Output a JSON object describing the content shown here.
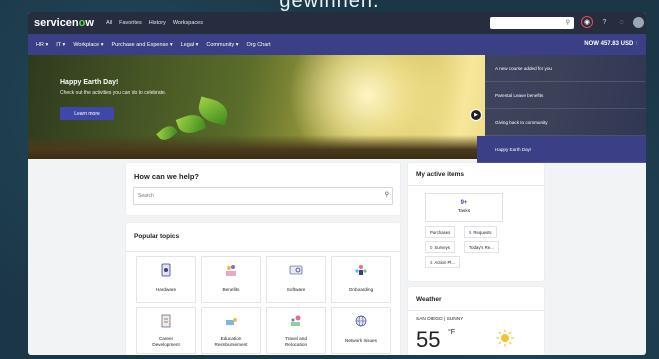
{
  "caption": "gewinnen.",
  "topbar": {
    "logo_pre": "servicen",
    "logo_o": "o",
    "logo_post": "w",
    "links": [
      "All",
      "Favorites",
      "History",
      "Workspaces"
    ]
  },
  "subnav": {
    "items": [
      "HR ▾",
      "IT ▾",
      "Workplace ▾",
      "Purchase and Expense ▾",
      "Legal ▾",
      "Community ▾",
      "Org Chart"
    ],
    "balance": "NOW 457.83 USD",
    "balance_arrow": "↑"
  },
  "hero": {
    "title": "Happy Earth Day!",
    "subtitle": "Check out the activities you can do to celebrate.",
    "button": "Learn more"
  },
  "carousel": {
    "items": [
      "A new course added for you",
      "Parental Leave benefits",
      "Giving back to community",
      "Happy Earth Day!"
    ],
    "current_index": 3
  },
  "help": {
    "title": "How can we help?",
    "search_placeholder": "Search"
  },
  "topics": {
    "title": "Popular topics",
    "tiles": [
      "Hardware",
      "Benefits",
      "Software",
      "Onboarding",
      "Career\nDevelopment",
      "Education\nReimbursement",
      "Travel and\nRelocation",
      "Network Issues"
    ]
  },
  "active_items": {
    "title": "My active items",
    "tasks_count": "9+",
    "tasks_label": "Tasks",
    "purchases": "Purchases",
    "requests_count": "5",
    "requests_label": "Requests",
    "surveys_count": "0",
    "surveys_label": "Surveys",
    "todays": "Today's Re...",
    "action_count": "3",
    "action_label": "Action Pl..."
  },
  "weather": {
    "title": "Weather",
    "location": "SAN DIEGO | SUNNY",
    "temp": "55",
    "unit": "°F"
  },
  "colors": {
    "topbar": "#262d3e",
    "subnav": "#3a3f86",
    "accent": "#3f48a8",
    "logo_o": "#62d84e"
  }
}
